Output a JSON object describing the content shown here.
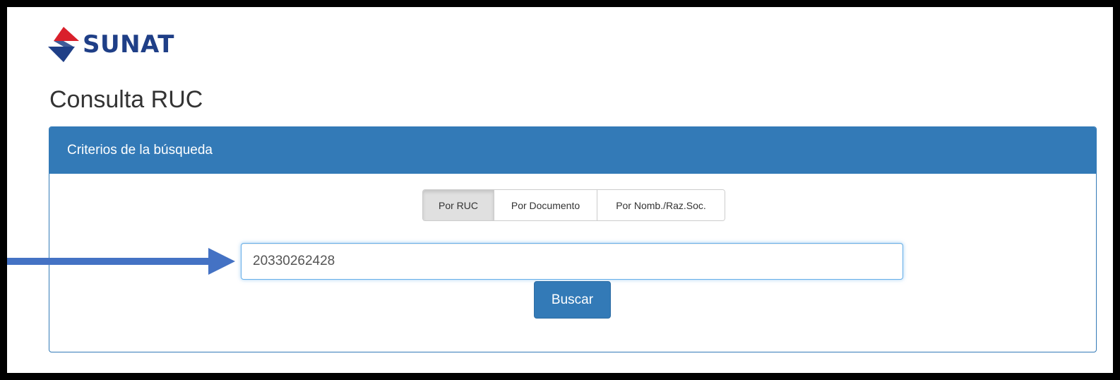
{
  "header": {
    "logo_text": "SUNAT"
  },
  "page": {
    "title": "Consulta RUC"
  },
  "panel": {
    "heading": "Criterios de la búsqueda",
    "tabs": [
      {
        "label": "Por RUC",
        "active": true
      },
      {
        "label": "Por Documento",
        "active": false
      },
      {
        "label": "Por Nomb./Raz.Soc.",
        "active": false
      }
    ],
    "ruc_input": {
      "value": "20330262428"
    },
    "search_label": "Buscar"
  },
  "colors": {
    "primary": "#337ab7",
    "logo_blue": "#1f3f87",
    "logo_red": "#d9202b",
    "annotation_arrow": "#4472c4"
  }
}
